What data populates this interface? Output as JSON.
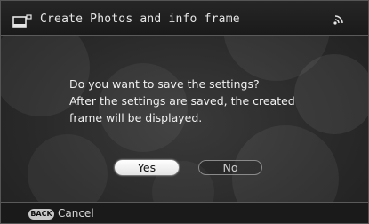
{
  "titlebar": {
    "title": "Create Photos and info frame",
    "left_icon": "frame-icon",
    "right_icon": "wireless-signal-icon"
  },
  "dialog": {
    "lines": [
      "Do you want to save the settings?",
      "After the settings are saved, the created",
      "frame will be displayed."
    ],
    "buttons": {
      "yes": "Yes",
      "no": "No"
    },
    "selected": "Yes"
  },
  "footer": {
    "back_key": "BACK",
    "cancel": "Cancel"
  },
  "colors": {
    "background": "#2a2a2a",
    "text": "#f0f0f0",
    "selected_button": "#ffffff"
  }
}
